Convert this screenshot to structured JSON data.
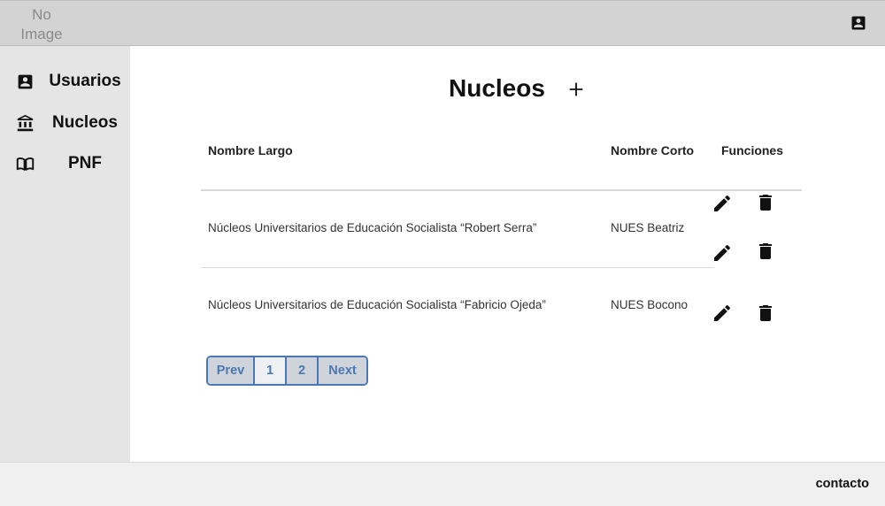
{
  "header": {
    "logo_text": "No Image",
    "account_icon": "account-box-icon"
  },
  "sidebar": {
    "items": [
      {
        "label": "Usuarios",
        "icon": "account-box-icon"
      },
      {
        "label": "Nucleos",
        "icon": "bank-icon"
      },
      {
        "label": "PNF",
        "icon": "book-open-icon"
      }
    ]
  },
  "main": {
    "title": "Nucleos",
    "add_icon": "plus-icon",
    "table": {
      "columns": [
        "Nombre Largo",
        "Nombre Corto",
        "Funciones"
      ],
      "rows": [
        {
          "nombre_largo": "Núcleos Universitarios de Educación Socialista “Robert Serra”",
          "nombre_corto": "NUES Beatriz"
        },
        {
          "nombre_largo": "Núcleos Universitarios de Educación Socialista “Fabricio Ojeda”",
          "nombre_corto": "NUES Bocono"
        }
      ],
      "row_actions": [
        "edit-icon",
        "delete-icon"
      ]
    },
    "pagination": {
      "prev": "Prev",
      "pages": [
        "1",
        "2"
      ],
      "next": "Next",
      "current": "1"
    }
  },
  "footer": {
    "contact": "contacto"
  }
}
